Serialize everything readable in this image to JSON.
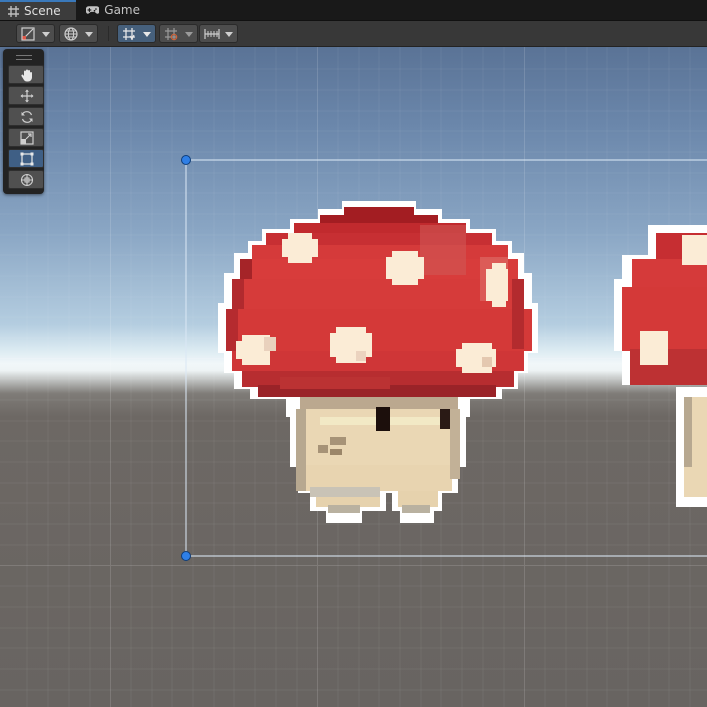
{
  "tabs": [
    {
      "label": "Scene",
      "icon": "hash-grid-icon",
      "active": true
    },
    {
      "label": "Game",
      "icon": "gamepad-icon",
      "active": false
    }
  ],
  "toolbar": {
    "buttons": [
      {
        "name": "shading-mode-dropdown",
        "icon": "shading-mode-icon"
      },
      {
        "name": "scene-view-mode-dropdown",
        "icon": "globe-icon"
      },
      {
        "name": "grid-snap-toggle",
        "icon": "grid-snap-icon",
        "active": true
      },
      {
        "name": "incremental-snap-dropdown",
        "icon": "increment-snap-icon"
      },
      {
        "name": "view-options-dropdown",
        "icon": "ruler-icon"
      }
    ]
  },
  "tools": [
    {
      "name": "view-tool",
      "icon": "hand-icon"
    },
    {
      "name": "move-tool",
      "icon": "move-arrows-icon"
    },
    {
      "name": "rotate-tool",
      "icon": "rotate-icon"
    },
    {
      "name": "scale-tool",
      "icon": "scale-icon"
    },
    {
      "name": "rect-tool",
      "icon": "rect-transform-icon",
      "active": true
    },
    {
      "name": "transform-tool",
      "icon": "transform-icon"
    }
  ],
  "colors": {
    "accent": "#3a79bb",
    "mushroom_cap": "#d33a3a",
    "mushroom_cap_dark": "#a01e22",
    "spots": "#fbecd6",
    "stem": "#ead7b4",
    "handle": "#2f7fe6"
  }
}
